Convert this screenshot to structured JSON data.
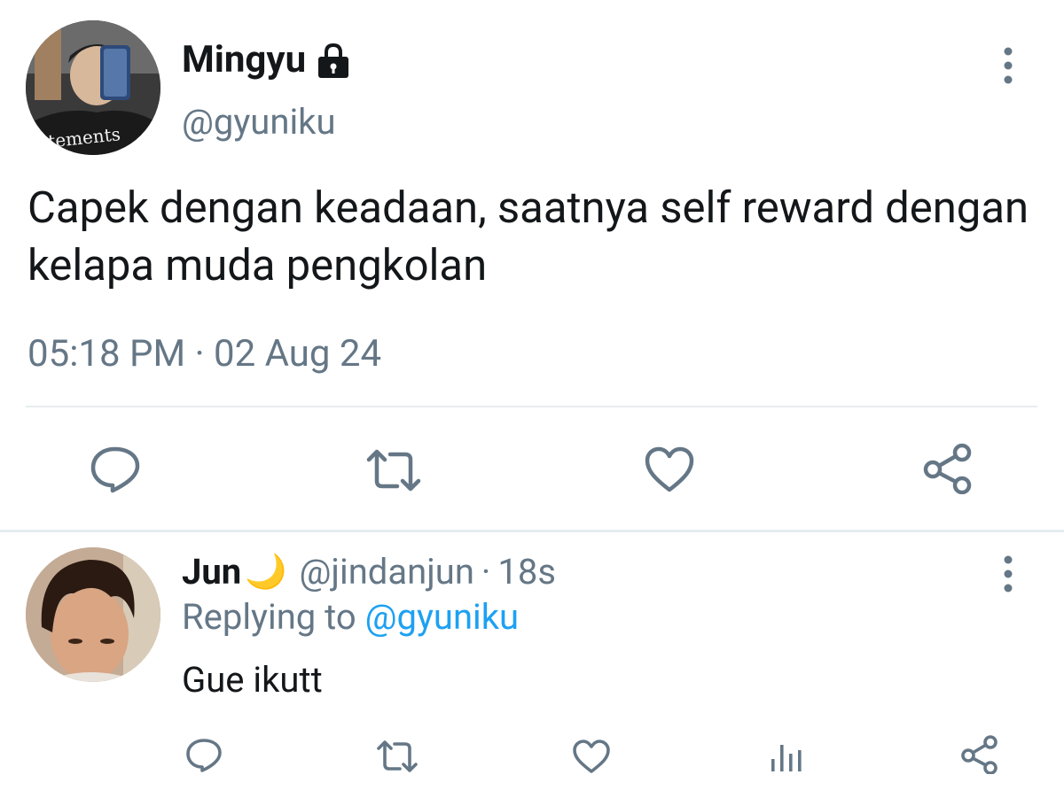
{
  "tweet": {
    "author": {
      "display_name": "Mingyu",
      "handle": "@gyuniku",
      "avatar_text": "etements",
      "protected_icon": "lock-icon"
    },
    "text": "Capek dengan keadaan, saatnya self reward dengan kelapa muda pengkolan",
    "timestamp": "05:18 PM · 02 Aug 24",
    "actions": [
      "reply-icon",
      "retweet-icon",
      "like-icon",
      "share-icon"
    ]
  },
  "reply": {
    "author": {
      "display_name": "Jun",
      "emoji": "🌙",
      "handle": "@jindanjun",
      "separator": "·",
      "time": "18s"
    },
    "replying_prefix": "Replying to",
    "replying_to": "@gyuniku",
    "text": "Gue ikutt",
    "actions": [
      "reply-icon",
      "retweet-icon",
      "like-icon",
      "analytics-icon",
      "share-icon"
    ]
  },
  "colors": {
    "text": "#14171a",
    "secondary": "#657786",
    "link": "#1da1f2",
    "icon": "#657786",
    "divider": "#e6ecf0",
    "moon": "#f5b921"
  }
}
